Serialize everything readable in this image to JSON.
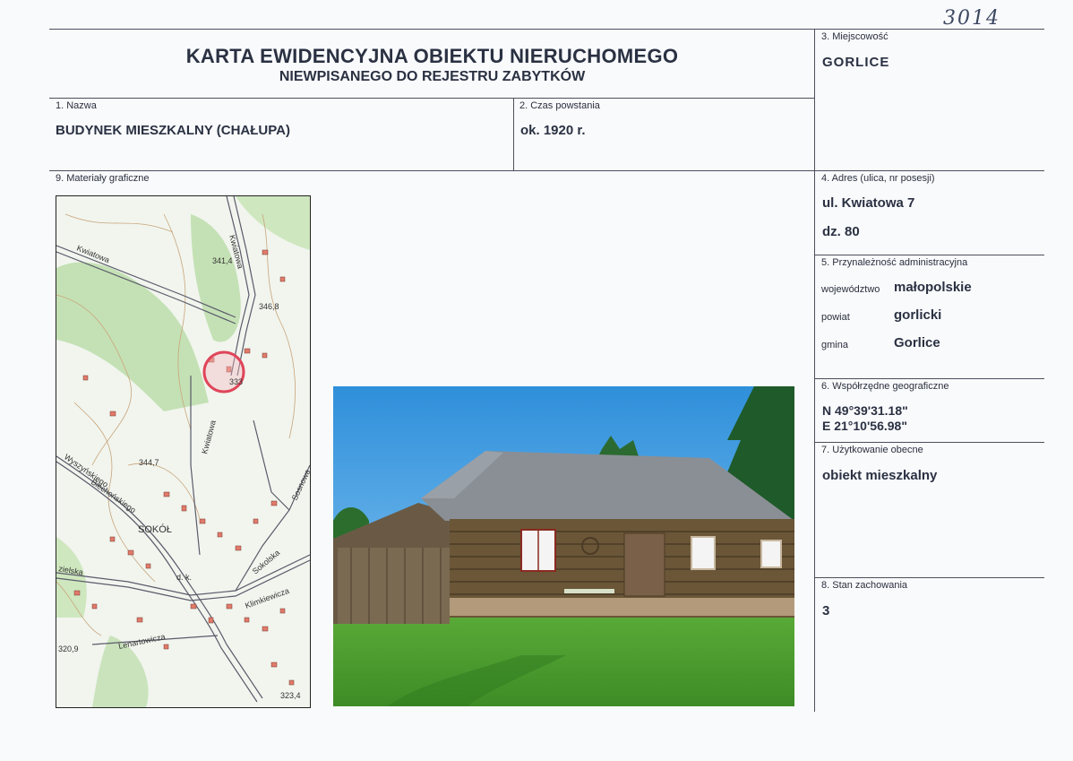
{
  "handwritten_number": "3014",
  "header": {
    "title": "KARTA EWIDENCYJNA OBIEKTU NIERUCHOMEGO",
    "subtitle": "NIEWPISANEGO DO REJESTRU ZABYTKÓW"
  },
  "fields": {
    "name": {
      "label": "1. Nazwa",
      "value": "BUDYNEK MIESZKALNY (CHAŁUPA)"
    },
    "time": {
      "label": "2. Czas powstania",
      "value": "ok. 1920 r."
    },
    "locality": {
      "label": "3. Miejscowość",
      "value": "GORLICE"
    },
    "address": {
      "label": "4. Adres (ulica, nr posesji)",
      "street": "ul. Kwiatowa 7",
      "plot": "dz. 80"
    },
    "admin": {
      "label": "5. Przynależność administracyjna",
      "rows": [
        {
          "key": "województwo",
          "value": "małopolskie"
        },
        {
          "key": "powiat",
          "value": "gorlicki"
        },
        {
          "key": "gmina",
          "value": "Gorlice"
        }
      ]
    },
    "coords": {
      "label": "6. Współrzędne geograficzne",
      "lat": "N 49°39'31.18\"",
      "lon": "E 21°10'56.98\""
    },
    "usage": {
      "label": "7. Użytkowanie obecne",
      "value": "obiekt mieszkalny"
    },
    "condition": {
      "label": "8. Stan zachowania",
      "value": "3"
    },
    "graphics": {
      "label": "9. Materiały graficzne"
    }
  },
  "map": {
    "labels": {
      "kwiatowa_top": "Kwiatowa",
      "kwiatowa_mid": "Kwiatowa",
      "kwiatowa_side": "Kwiatowa",
      "h341": "341,4",
      "h346": "346,8",
      "h333": "333",
      "h344": "344,7",
      "biecka": "Biechońskiego",
      "sokol": "SOKÓŁ",
      "sokolska": "Sokolska",
      "dk": "d. k.",
      "klimkiewicza": "Klimkiewicza",
      "lenartowicza": "Lenartowicza",
      "h320": "320,9",
      "h323": "323,4",
      "zielska": "zielska",
      "wyszynskiego": "Wyszyńskiego",
      "sosnowa": "Sosnowa"
    },
    "marker_color": "#e0455a"
  },
  "colors": {
    "sky": "#3f9be0",
    "grass": "#4fa233",
    "roof": "#8a8f96",
    "wood": "#6b5638"
  }
}
